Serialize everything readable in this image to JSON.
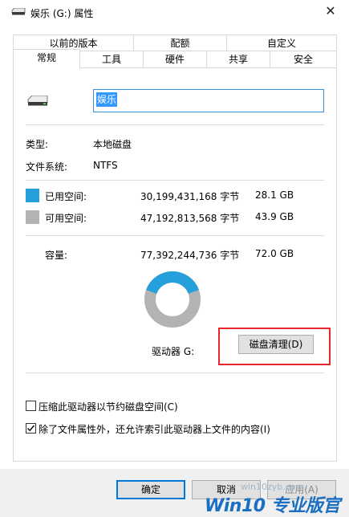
{
  "window": {
    "title": "娱乐 (G:) 属性",
    "close_glyph": "✕"
  },
  "tabs_row1": [
    "以前的版本",
    "配额",
    "自定义"
  ],
  "tabs_row2": [
    "常规",
    "工具",
    "硬件",
    "共享",
    "安全"
  ],
  "active_tab": "常规",
  "general": {
    "name_value": "娱乐",
    "type_label": "类型:",
    "type_value": "本地磁盘",
    "fs_label": "文件系统:",
    "fs_value": "NTFS",
    "used_label": "已用空间:",
    "used_bytes": "30,199,431,168 字节",
    "used_size": "28.1 GB",
    "free_label": "可用空间:",
    "free_bytes": "47,192,813,568 字节",
    "free_size": "43.9 GB",
    "capacity_label": "容量:",
    "capacity_bytes": "77,392,244,736 字节",
    "capacity_size": "72.0 GB",
    "drive_label": "驱动器 G:",
    "cleanup_button": "磁盘清理(D)",
    "compress_label": "压缩此驱动器以节约磁盘空间(C)",
    "compress_checked": false,
    "index_label": "除了文件属性外，还允许索引此驱动器上文件的内容(I)",
    "index_checked": true,
    "used_fraction": 0.39
  },
  "buttons": {
    "ok": "确定",
    "cancel": "取消",
    "apply": "应用(A)"
  },
  "colors": {
    "used": "#26a0da",
    "free": "#b3b3b3",
    "highlight": "#e8242c"
  },
  "watermark": {
    "url": "win10zyb.com",
    "brand": "Win10 专业版官网"
  }
}
